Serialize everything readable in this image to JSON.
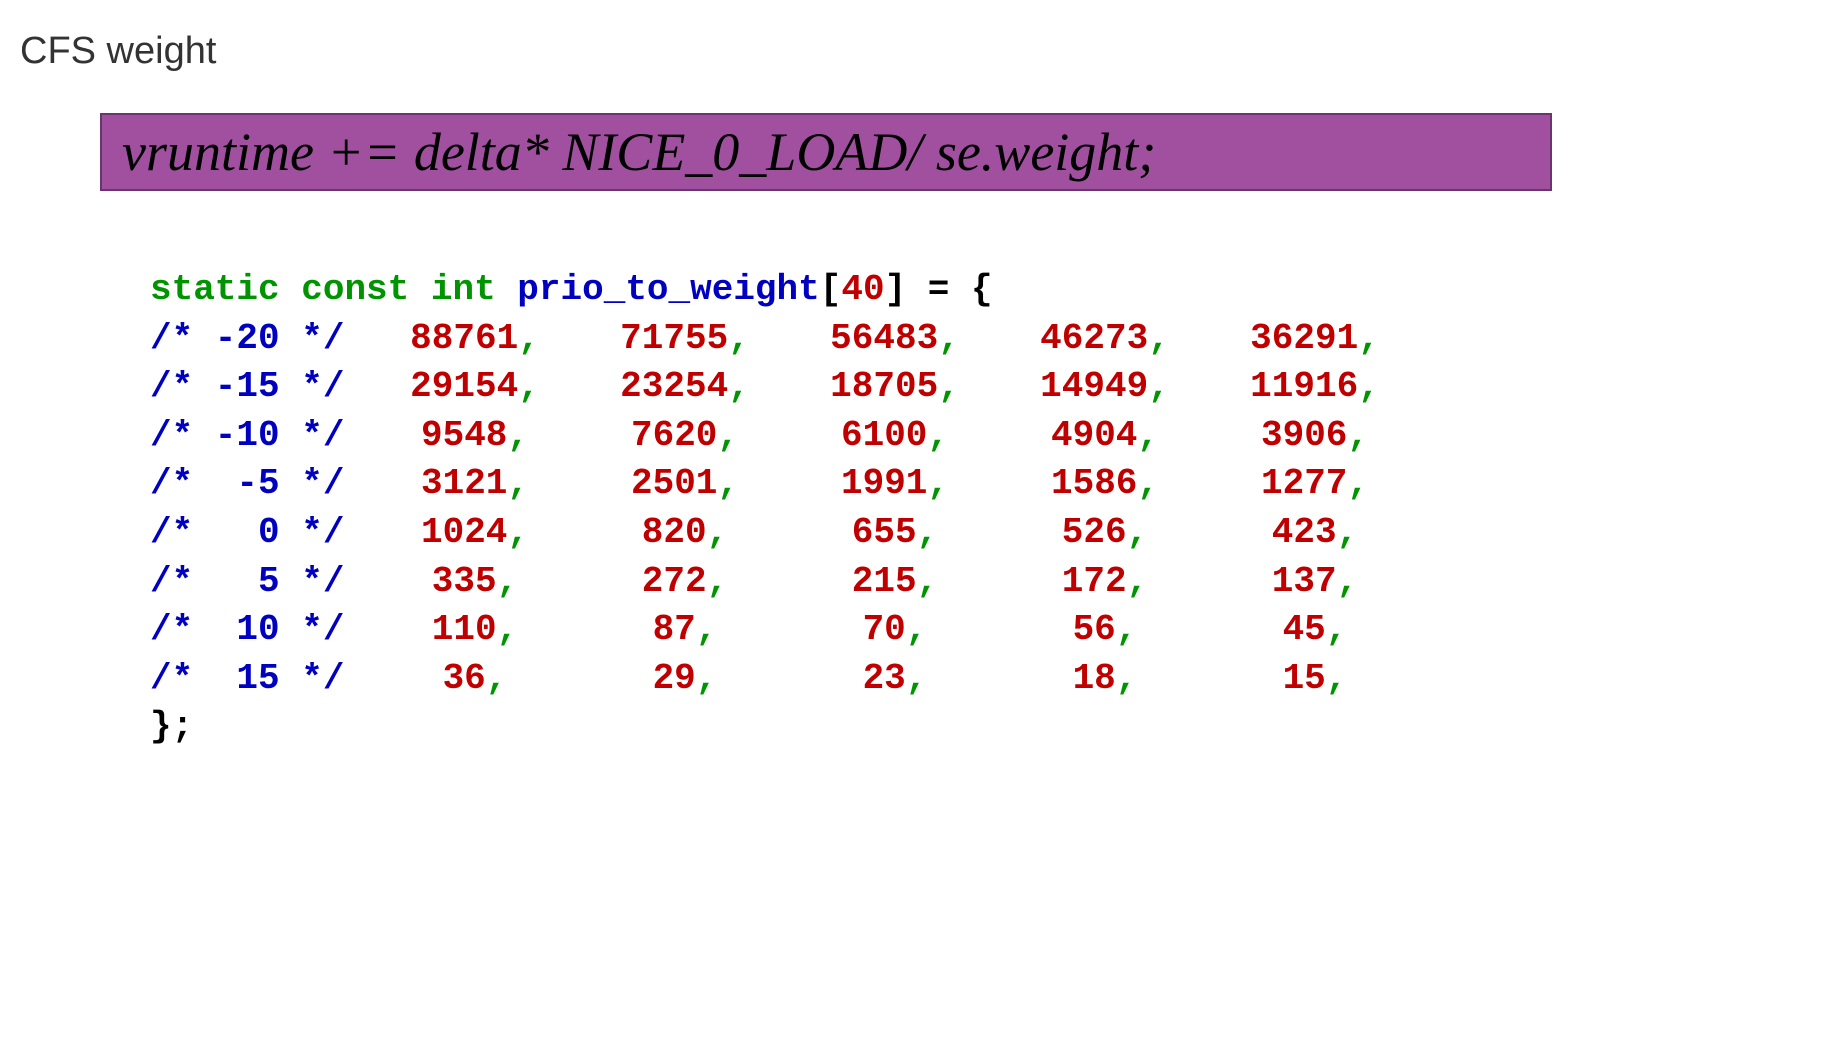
{
  "title": "CFS  weight",
  "formula": "vruntime +=  delta* NICE_0_LOAD/ se.weight;",
  "code": {
    "decl": {
      "kw_static": "static",
      "kw_const": "const",
      "kw_int": "int",
      "name": "prio_to_weight",
      "bracket_open": "[",
      "size": "40",
      "bracket_close": "]",
      "equals": " = ",
      "brace_open": "{"
    },
    "rows": [
      {
        "comment": "/* -20 */",
        "vals": [
          "88761",
          "71755",
          "56483",
          "46273",
          "36291"
        ]
      },
      {
        "comment": "/* -15 */",
        "vals": [
          "29154",
          "23254",
          "18705",
          "14949",
          "11916"
        ]
      },
      {
        "comment": "/* -10 */",
        "vals": [
          "9548",
          "7620",
          "6100",
          "4904",
          "3906"
        ]
      },
      {
        "comment": "/*  -5 */",
        "vals": [
          "3121",
          "2501",
          "1991",
          "1586",
          "1277"
        ]
      },
      {
        "comment": "/*   0 */",
        "vals": [
          "1024",
          "820",
          "655",
          "526",
          "423"
        ]
      },
      {
        "comment": "/*   5 */",
        "vals": [
          "335",
          "272",
          "215",
          "172",
          "137"
        ]
      },
      {
        "comment": "/*  10 */",
        "vals": [
          "110",
          "87",
          "70",
          "56",
          "45"
        ]
      },
      {
        "comment": "/*  15 */",
        "vals": [
          "36",
          "29",
          "23",
          "18",
          "15"
        ]
      }
    ],
    "brace_close": "};"
  }
}
